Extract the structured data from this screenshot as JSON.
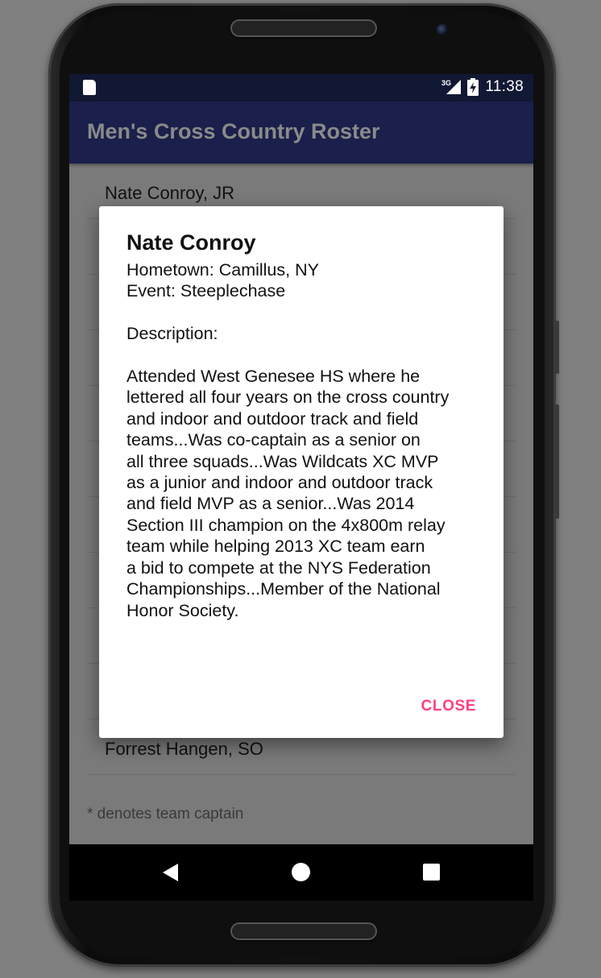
{
  "status_bar": {
    "network": "3G",
    "time": "11:38"
  },
  "app_bar": {
    "title": "Men's Cross Country Roster"
  },
  "roster": {
    "items": [
      "Nate Conroy, JR",
      "",
      "",
      "",
      "",
      "",
      "",
      "",
      "",
      "",
      "Forrest Hangen, SO"
    ],
    "footer_note": "* denotes team captain"
  },
  "dialog": {
    "title": "Nate Conroy",
    "message": "Hometown: Camillus, NY\nEvent: Steeplechase\n\nDescription:\n\nAttended West Genesee HS where he\nlettered all four years on the cross country\nand indoor and outdoor track and field\nteams...Was co-captain as a senior on\nall three squads...Was Wildcats XC MVP\nas a junior and indoor and outdoor track\nand field MVP as a senior...Was 2014\nSection III champion on the 4x800m relay\nteam while helping 2013 XC team earn\na bid to compete at the NYS Federation\nChampionships...Member of the National\nHonor Society.",
    "close_label": "CLOSE"
  },
  "colors": {
    "status_bar": "#111833",
    "app_bar": "#1a1f4b",
    "accent": "#ff4081",
    "scrim_background": "#7a7a7a"
  }
}
